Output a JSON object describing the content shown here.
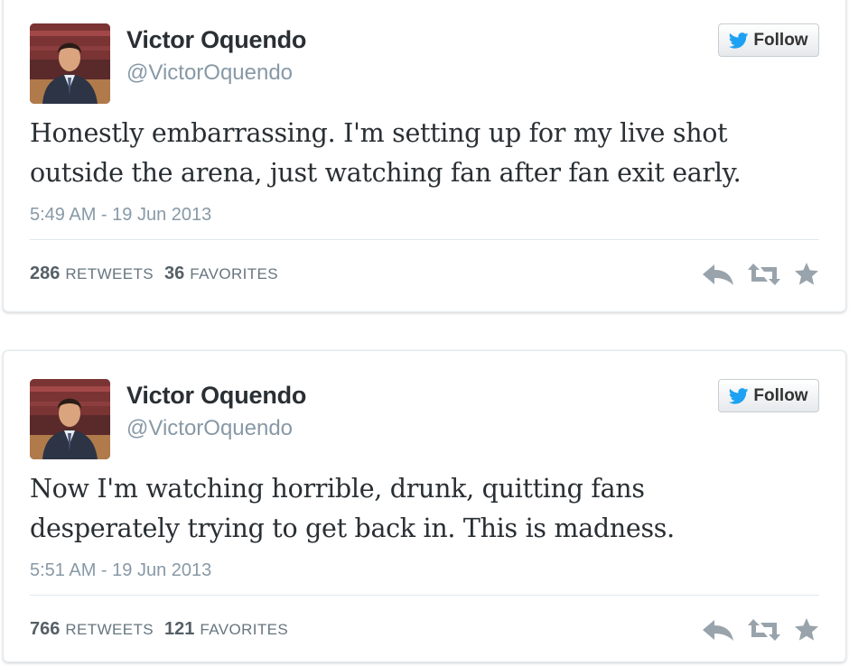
{
  "colors": {
    "name": "#292f33",
    "handle": "#8899a6",
    "bird": "#1da1f2",
    "action_icons": "#99a3ab"
  },
  "tweets": [
    {
      "author_name": "Victor Oquendo",
      "author_handle": "@VictorOquendo",
      "follow_label": "Follow",
      "text_line1": "Honestly embarrassing. I'm setting up for my live shot",
      "text_line2": "outside the arena, just watching fan after fan exit early.",
      "timestamp": "5:49 AM - 19 Jun 2013",
      "retweet_count": "286",
      "retweet_label": "RETWEETS",
      "favorite_count": "36",
      "favorite_label": "FAVORITES",
      "icons": [
        "reply-icon",
        "retweet-icon",
        "favorite-icon"
      ]
    },
    {
      "author_name": "Victor Oquendo",
      "author_handle": "@VictorOquendo",
      "follow_label": "Follow",
      "text_line1": "Now I'm watching horrible, drunk, quitting fans",
      "text_line2": "desperately trying to get back in. This is madness.",
      "timestamp": "5:51 AM - 19 Jun 2013",
      "retweet_count": "766",
      "retweet_label": "RETWEETS",
      "favorite_count": "121",
      "favorite_label": "FAVORITES",
      "icons": [
        "reply-icon",
        "retweet-icon",
        "favorite-icon"
      ]
    }
  ]
}
